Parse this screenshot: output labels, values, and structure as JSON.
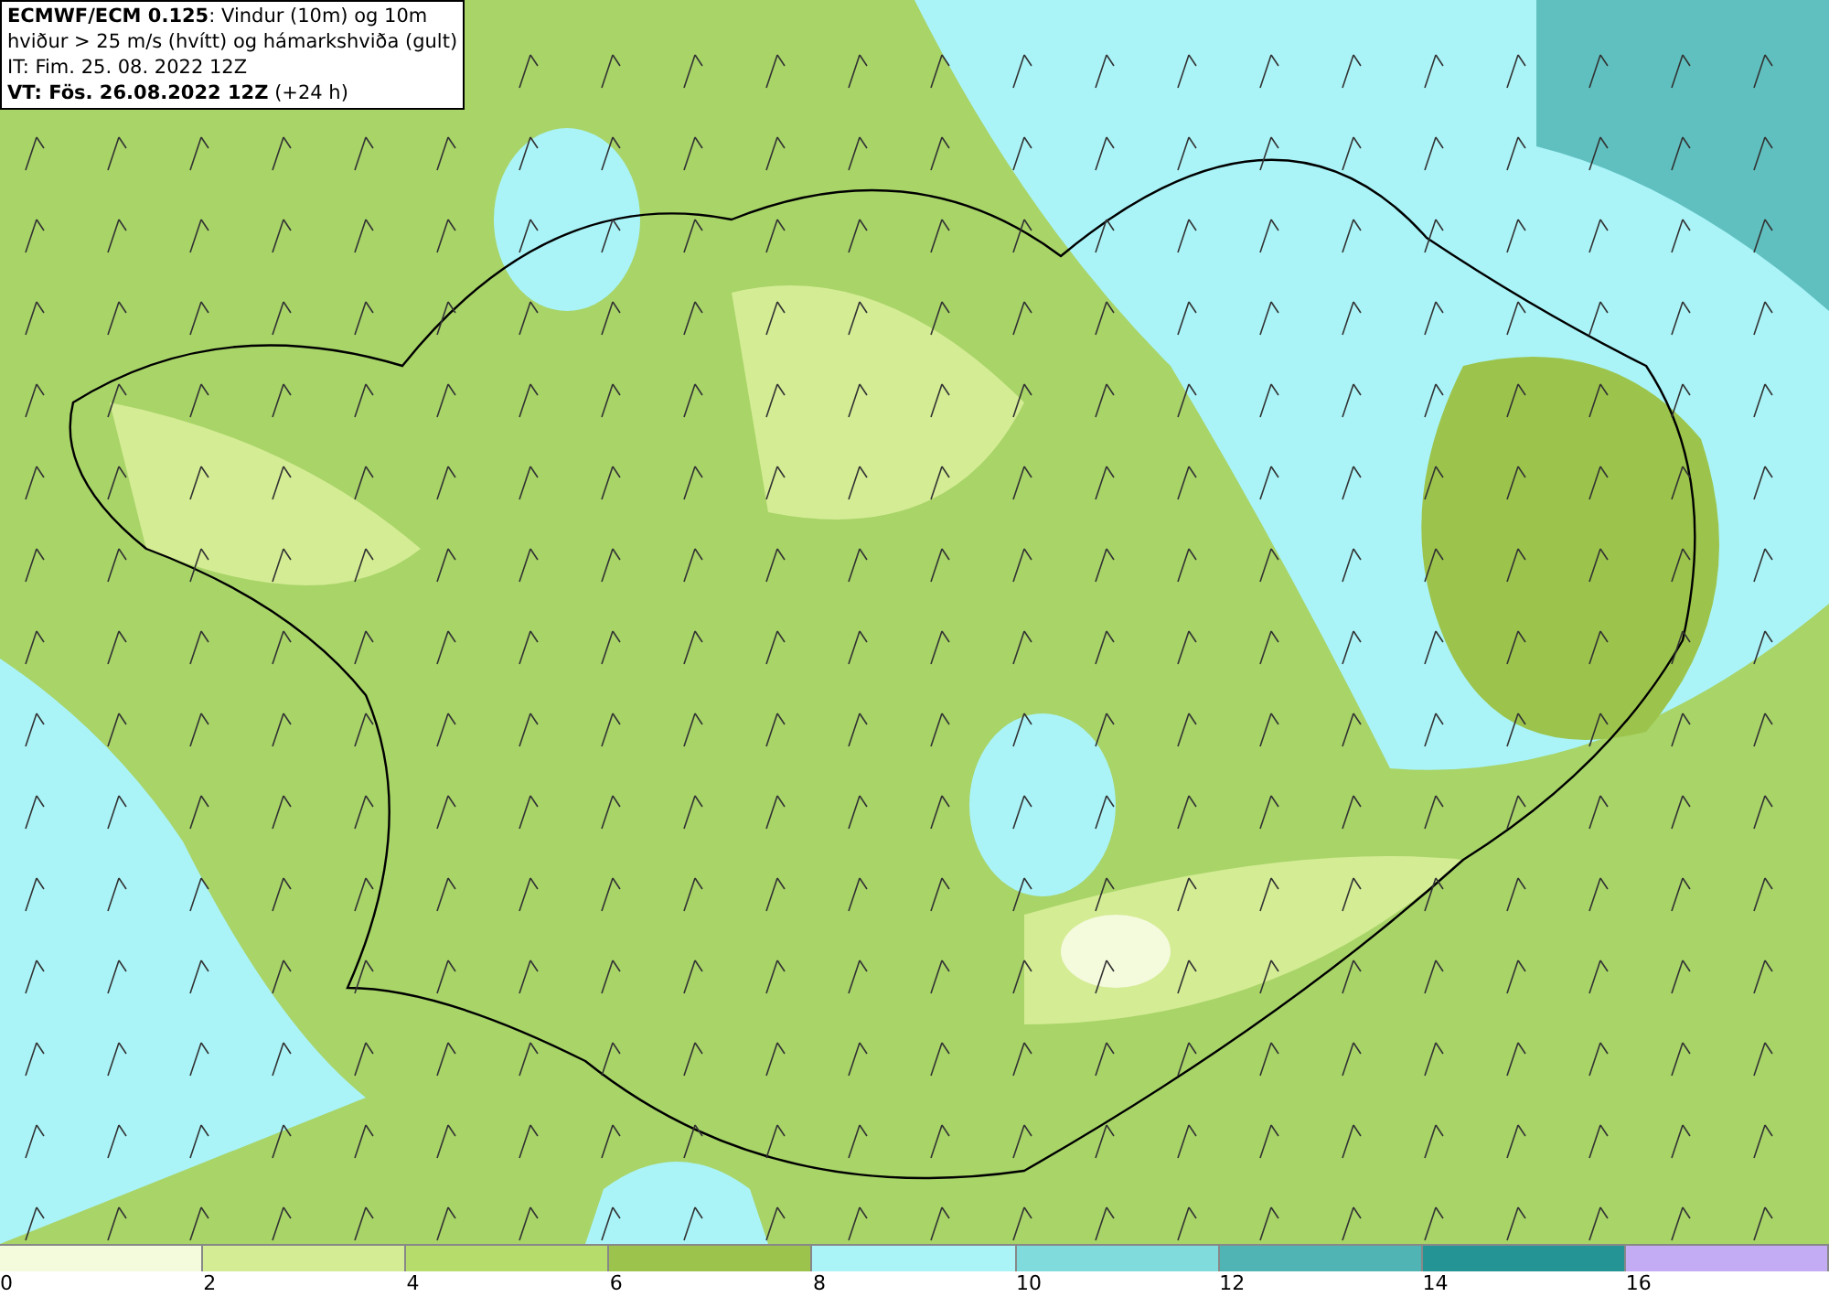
{
  "info_box": {
    "lines": [
      "**ECMWF/ECM 0.125**: Vindur (10m) og 10m",
      "hviður > 25 m/s (hvítt) og hámarkshviða (gult)",
      "IT: Fim. 25. 08. 2022 12Z",
      "**VT: Fös. 26.08.2022 12Z** (+24 h)"
    ]
  },
  "legend": {
    "bins": [
      {
        "color": "#f4fadc",
        "label": "0"
      },
      {
        "color": "#d4ec94",
        "label": "2"
      },
      {
        "color": "#b6dc6c",
        "label": "4"
      },
      {
        "color": "#9cc44c",
        "label": "6"
      },
      {
        "color": "#aaf4f8",
        "label": "8"
      },
      {
        "color": "#80dcdc",
        "label": "10"
      },
      {
        "color": "#50b4b4",
        "label": "12"
      },
      {
        "color": "#249494",
        "label": "14"
      },
      {
        "color": "#c4acf4",
        "label": "16"
      }
    ]
  }
}
